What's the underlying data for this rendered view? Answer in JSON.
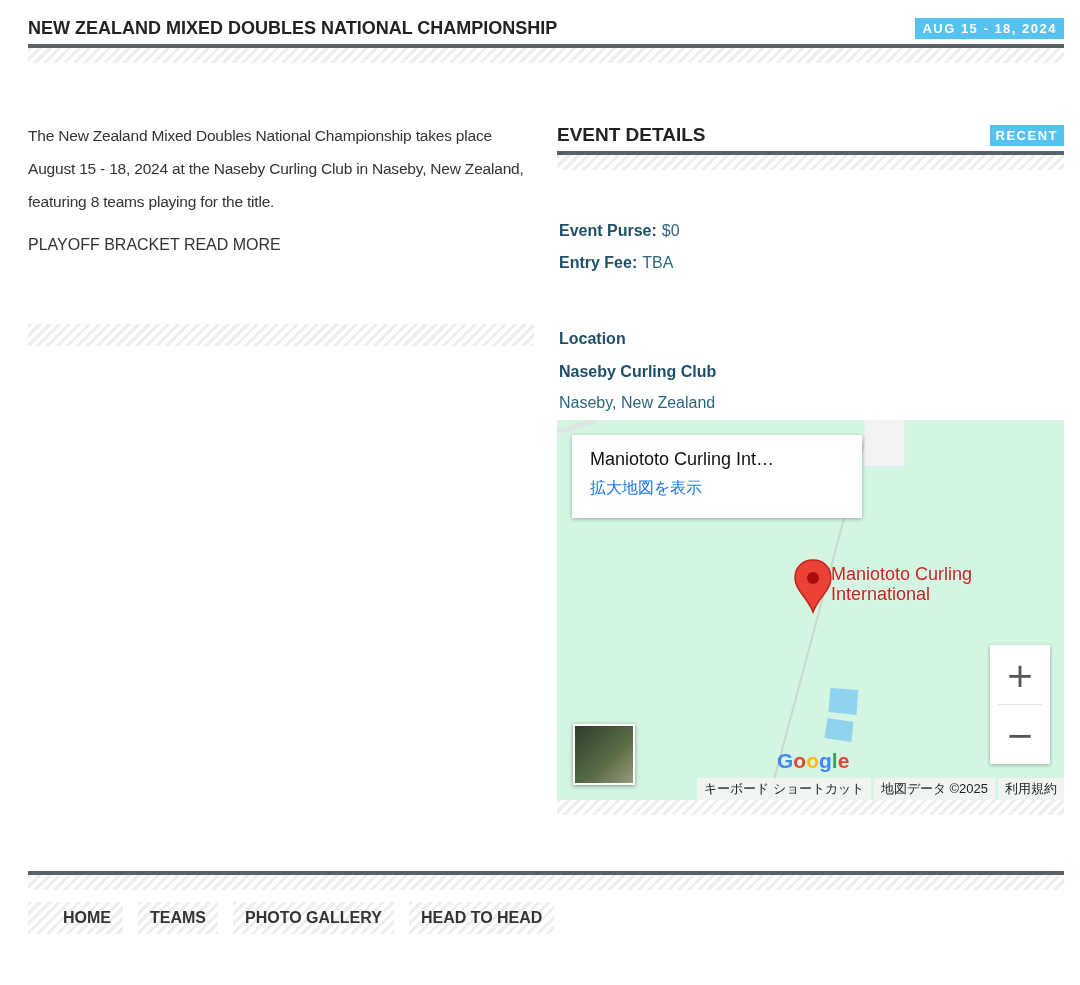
{
  "header": {
    "title": "NEW ZEALAND MIXED DOUBLES NATIONAL CHAMPIONSHIP",
    "date_badge": "AUG 15 - 18, 2024"
  },
  "intro": {
    "text": "The New Zealand Mixed Doubles National Championship takes place August 15 - 18, 2024 at the Naseby Curling Club in Naseby, New Zealand, featuring 8 teams playing for the title.",
    "link": "PLAYOFF BRACKET READ MORE"
  },
  "event_details": {
    "title": "EVENT DETAILS",
    "badge": "RECENT",
    "facts": [
      {
        "label": "Event Purse:",
        "value": "$0"
      },
      {
        "label": "Entry Fee:",
        "value": "TBA"
      }
    ],
    "location_heading": "Location",
    "venue": "Naseby Curling Club",
    "place": "Naseby, New Zealand"
  },
  "map": {
    "card_title": "Maniototo Curling Int…",
    "card_link": "拡大地図を表示",
    "pin_label": "Maniototo Curling International",
    "zoom_in": "+",
    "zoom_out": "−",
    "logo": "Google",
    "attribution": [
      "キーボード ショートカット",
      "地図データ ©2025",
      "利用規約"
    ]
  },
  "footer_nav": [
    "HOME",
    "TEAMS",
    "PHOTO GALLERY",
    "HEAD TO HEAD"
  ]
}
